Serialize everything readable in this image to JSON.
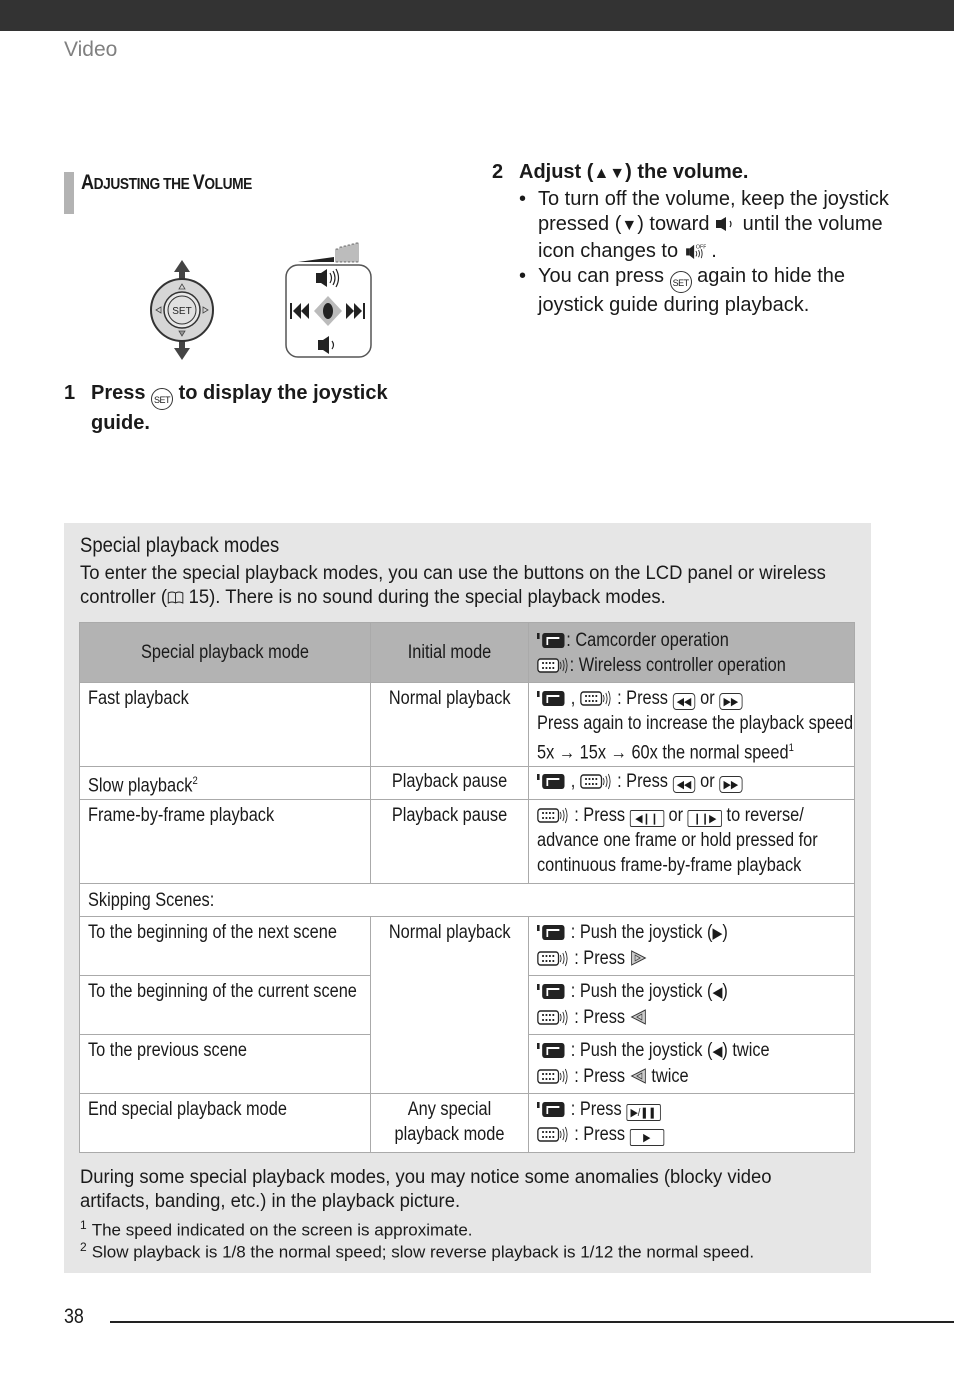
{
  "header": {
    "section": "Video"
  },
  "heading": {
    "first_cap": "A",
    "part1": "DJUSTING THE ",
    "second_cap": "V",
    "part2": "OLUME"
  },
  "figure": {
    "set_label": "SET"
  },
  "step1": {
    "number": "1",
    "before": "Press ",
    "icon": "SET",
    "after": " to display the joystick guide."
  },
  "step2": {
    "number": "2",
    "title_before": "Adjust (",
    "title_arrows": "▲▼",
    "title_after": ") the volume.",
    "bullets": [
      {
        "before": "To turn off the volume, keep the joystick pressed (",
        "arrow": "▼",
        "mid": ") toward ",
        "after": " until the volume icon changes to ",
        "end": " ."
      },
      {
        "before": "You can press ",
        "icon": "SET",
        "after": " again to hide the joystick guide during playback."
      }
    ]
  },
  "panel": {
    "title": "Special playback modes",
    "intro_before": "To enter the special playback modes, you can use the buttons on the LCD panel or wireless controller (",
    "intro_page": " 15). There is no sound during the special playback modes.",
    "table": {
      "headers": {
        "mode": "Special playback mode",
        "initial": "Initial mode",
        "legend_camcorder": ": Camcorder operation",
        "legend_wireless": ": Wireless controller operation"
      },
      "rows": [
        {
          "mode": "Fast playback",
          "initial": "Normal playback",
          "line1": " : Press ",
          "or": " or ",
          "line2": "Press again to increase the playback speed",
          "line3": "5x → 15x → 60x the normal speed",
          "sup": "1"
        },
        {
          "mode": "Slow playback",
          "mode_sup": "2",
          "initial": "Playback pause",
          "line1": " : Press ",
          "or": " or "
        },
        {
          "mode": "Frame-by-frame playback",
          "initial": "Playback pause",
          "line1": " : Press ",
          "or": " or ",
          "after": " to reverse/",
          "line2": "advance one frame or hold pressed for",
          "line3": "continuous frame-by-frame playback"
        },
        {
          "section": "Skipping Scenes:"
        },
        {
          "mode": "To the beginning of the next scene",
          "initial": "Normal playback",
          "cam": " : Push the joystick (",
          "cam_arrow": "▶",
          "cam_end": ")",
          "rc": " : Press "
        },
        {
          "mode": "To the beginning of the current scene",
          "cam": " : Push the joystick (",
          "cam_arrow": "◀",
          "cam_end": ")",
          "rc": " : Press "
        },
        {
          "mode": "To the previous scene",
          "cam": " : Push the joystick (",
          "cam_arrow": "◀",
          "cam_end": ") twice",
          "rc": " : Press ",
          "rc_end": " twice"
        },
        {
          "mode": "End special playback mode",
          "initial_l1": "Any special",
          "initial_l2": "playback mode",
          "cam": " : Press ",
          "cam_key": "▶/❚❚",
          "rc": " : Press ",
          "rc_key": "▶"
        }
      ],
      "keys": {
        "rew": "◀◀",
        "ff": "▶▶",
        "frame_rev": "◀❙❙",
        "frame_fwd": "❙❙▶"
      }
    },
    "note": "During some special playback modes, you may notice some anomalies (blocky video artifacts, banding, etc.) in the playback picture.",
    "footnotes": [
      {
        "mark": "1",
        "text": "The speed indicated on the screen is approximate."
      },
      {
        "mark": "2",
        "text": "Slow playback is 1/8 the normal speed; slow reverse playback is 1/12 the normal speed."
      }
    ]
  },
  "footer": {
    "page_number": "38"
  }
}
